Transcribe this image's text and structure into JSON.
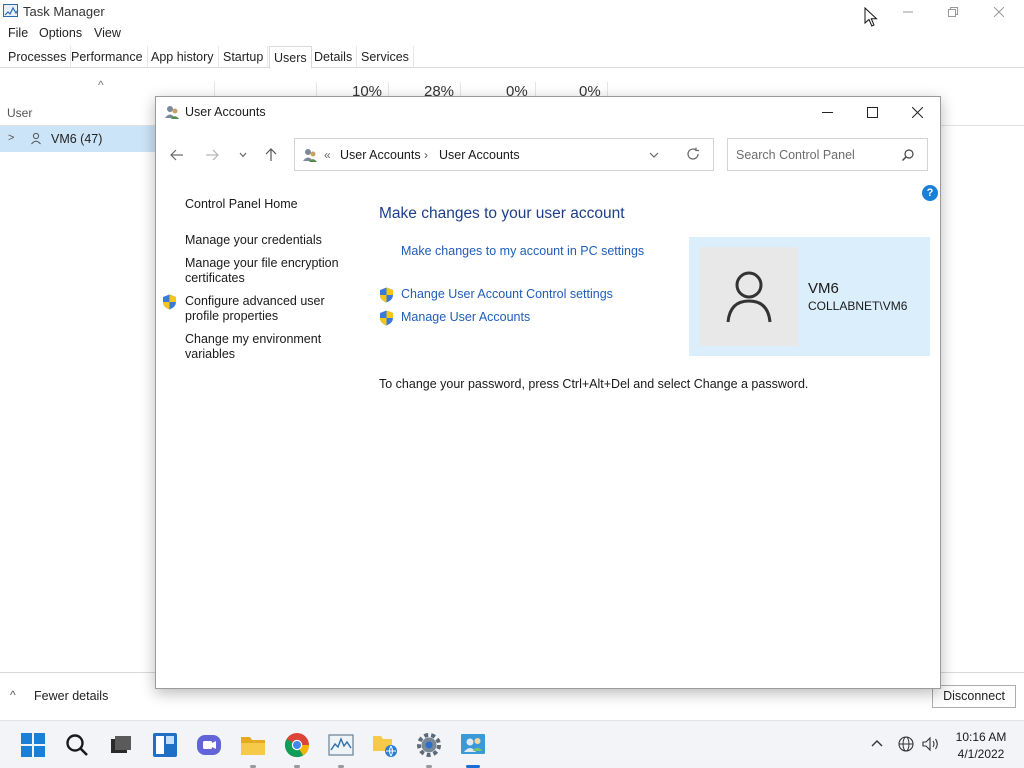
{
  "task_manager": {
    "title": "Task Manager",
    "menu": [
      "File",
      "Options",
      "View"
    ],
    "tabs": [
      "Processes",
      "Performance",
      "App history",
      "Startup",
      "Users",
      "Details",
      "Services"
    ],
    "active_tab": "Users",
    "column_user": "User",
    "usage": [
      "10%",
      "28%",
      "0%",
      "0%"
    ],
    "row_label": "VM6 (47)",
    "fewer_details": "Fewer details",
    "disconnect_label": "Disconnect"
  },
  "user_accounts": {
    "title": "User Accounts",
    "breadcrumb": [
      "User Accounts",
      "User Accounts"
    ],
    "search_placeholder": "Search Control Panel",
    "sidebar": {
      "home": "Control Panel Home",
      "credentials": "Manage your credentials",
      "encryption": "Manage your file encryption certificates",
      "profile": "Configure advanced user profile properties",
      "environment": "Change my environment variables"
    },
    "heading": "Make changes to your user account",
    "pc_settings_link": "Make changes to my account in PC settings",
    "uac_link": "Change User Account Control settings",
    "manage_link": "Manage User Accounts",
    "password_note": "To change your password, press Ctrl+Alt+Del and select Change a password.",
    "account_name": "VM6",
    "account_domain": "COLLABNET\\VM6"
  },
  "taskbar": {
    "time": "10:16 AM",
    "date": "4/1/2022",
    "pinned_icons": [
      "start-icon",
      "search-icon",
      "task-view-icon",
      "widgets-icon",
      "chat-icon",
      "file-explorer-icon",
      "chrome-icon",
      "performance-monitor-icon",
      "network-folder-icon",
      "settings-icon",
      "user-accounts-icon"
    ]
  },
  "colors": {
    "accent": "#1a7fd6",
    "link": "#1f5db8",
    "heading": "#1e3f8a",
    "selection": "#cce4f7",
    "account_card": "#daeefc"
  }
}
